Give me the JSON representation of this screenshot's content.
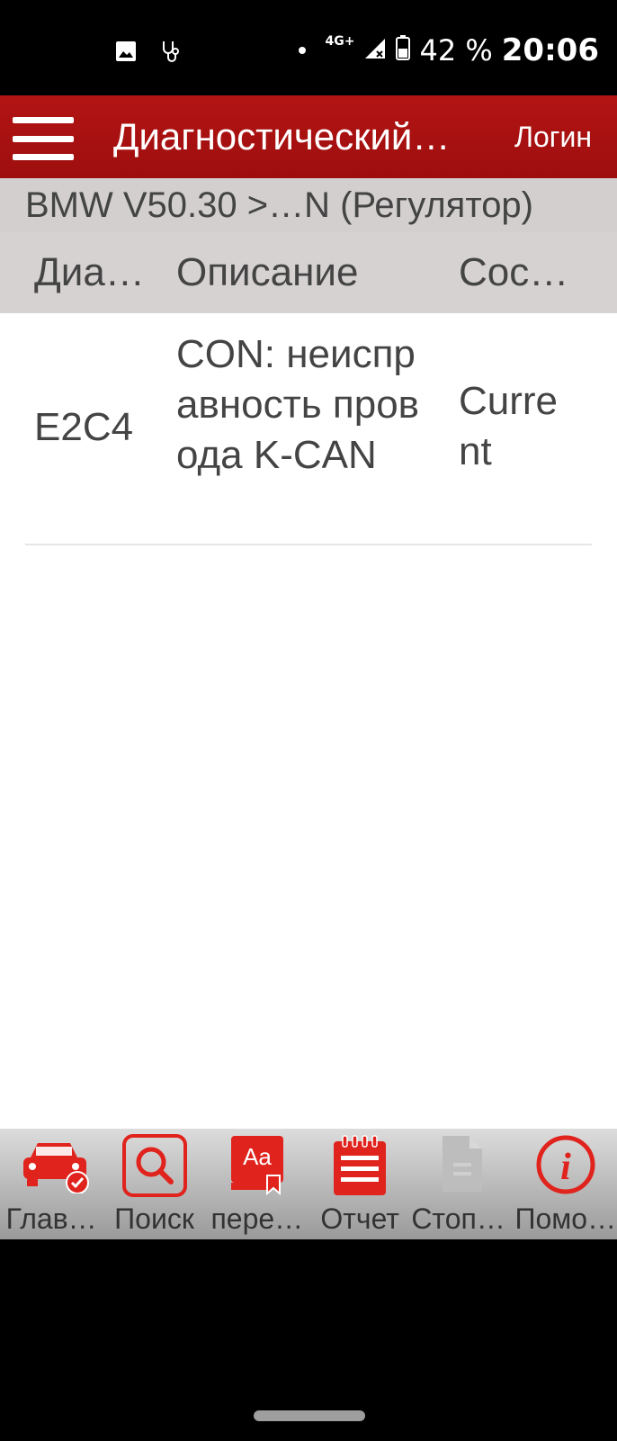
{
  "status_bar": {
    "network": "4G+",
    "battery": "42 %",
    "time": "20:06"
  },
  "app_bar": {
    "title": "Диагностический…",
    "login_label": "Логин"
  },
  "breadcrumb": "BMW V50.30 >…N (Регулятор)",
  "table": {
    "headers": [
      "Диа…",
      "Описание",
      "Сос…"
    ],
    "rows": [
      {
        "code": "E2C4",
        "description": "CON: неисправность провода K-CAN",
        "status": "Current"
      }
    ]
  },
  "toolbar": {
    "items": [
      {
        "label": "Глав…",
        "icon": "car-check-icon"
      },
      {
        "label": "Поиск",
        "icon": "search-icon"
      },
      {
        "label": "пере…",
        "icon": "translate-icon"
      },
      {
        "label": "Отчет",
        "icon": "report-icon"
      },
      {
        "label": "Стоп-…",
        "icon": "document-icon"
      },
      {
        "label": "Помо…",
        "icon": "info-icon"
      }
    ]
  },
  "colors": {
    "accent": "#b31414",
    "icon_red": "#e0231c",
    "disabled": "#bdbdbd"
  }
}
